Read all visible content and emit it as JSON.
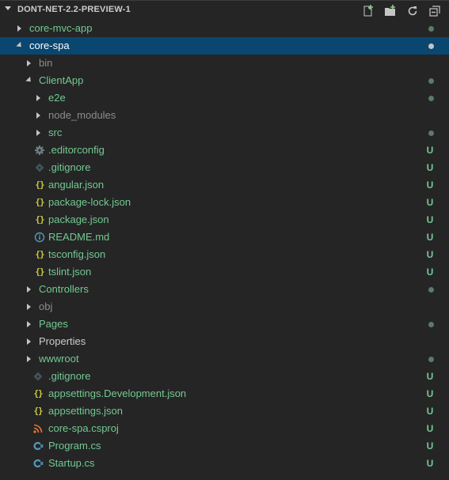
{
  "explorer": {
    "title": "DONT-NET-2.2-PREVIEW-1",
    "actions": [
      {
        "name": "new-file-icon",
        "label": "New File"
      },
      {
        "name": "new-folder-icon",
        "label": "New Folder"
      },
      {
        "name": "refresh-icon",
        "label": "Refresh Explorer"
      },
      {
        "name": "collapse-all-icon",
        "label": "Collapse All"
      }
    ]
  },
  "colors": {
    "untracked": "#73c991",
    "modified_dot": "#73c991",
    "ignored": "#8c8c8c",
    "default": "#cccccc",
    "selected_bg": "#094771",
    "json_icon": "#cbcb41",
    "info_icon": "#519aba",
    "xml_icon": "#e37933",
    "csharp_icon": "#519aba",
    "gear_icon": "#6d8086"
  },
  "tree": [
    {
      "label": "core-mvc-app",
      "kind": "folder",
      "expanded": false,
      "depth": 0,
      "color": "untracked",
      "status": "dot",
      "icon": "none"
    },
    {
      "label": "core-spa",
      "kind": "folder",
      "expanded": true,
      "depth": 0,
      "color": "default",
      "status": "dot",
      "icon": "none",
      "selected": true
    },
    {
      "label": "bin",
      "kind": "folder",
      "expanded": false,
      "depth": 1,
      "color": "ignored",
      "status": "",
      "icon": "none"
    },
    {
      "label": "ClientApp",
      "kind": "folder",
      "expanded": true,
      "depth": 1,
      "color": "untracked",
      "status": "dot",
      "icon": "none"
    },
    {
      "label": "e2e",
      "kind": "folder",
      "expanded": false,
      "depth": 2,
      "color": "untracked",
      "status": "dot",
      "icon": "none"
    },
    {
      "label": "node_modules",
      "kind": "folder",
      "expanded": false,
      "depth": 2,
      "color": "ignored",
      "status": "",
      "icon": "none"
    },
    {
      "label": "src",
      "kind": "folder",
      "expanded": false,
      "depth": 2,
      "color": "untracked",
      "status": "dot",
      "icon": "none"
    },
    {
      "label": ".editorconfig",
      "kind": "file",
      "depth": 2,
      "color": "untracked",
      "status": "U",
      "icon": "gear-icon"
    },
    {
      "label": ".gitignore",
      "kind": "file",
      "depth": 2,
      "color": "untracked",
      "status": "U",
      "icon": "git-icon"
    },
    {
      "label": "angular.json",
      "kind": "file",
      "depth": 2,
      "color": "untracked",
      "status": "U",
      "icon": "json-icon"
    },
    {
      "label": "package-lock.json",
      "kind": "file",
      "depth": 2,
      "color": "untracked",
      "status": "U",
      "icon": "json-icon"
    },
    {
      "label": "package.json",
      "kind": "file",
      "depth": 2,
      "color": "untracked",
      "status": "U",
      "icon": "json-icon"
    },
    {
      "label": "README.md",
      "kind": "file",
      "depth": 2,
      "color": "untracked",
      "status": "U",
      "icon": "info-icon"
    },
    {
      "label": "tsconfig.json",
      "kind": "file",
      "depth": 2,
      "color": "untracked",
      "status": "U",
      "icon": "json-icon"
    },
    {
      "label": "tslint.json",
      "kind": "file",
      "depth": 2,
      "color": "untracked",
      "status": "U",
      "icon": "json-icon"
    },
    {
      "label": "Controllers",
      "kind": "folder",
      "expanded": false,
      "depth": 1,
      "color": "untracked",
      "status": "dot",
      "icon": "none"
    },
    {
      "label": "obj",
      "kind": "folder",
      "expanded": false,
      "depth": 1,
      "color": "ignored",
      "status": "",
      "icon": "none"
    },
    {
      "label": "Pages",
      "kind": "folder",
      "expanded": false,
      "depth": 1,
      "color": "untracked",
      "status": "dot",
      "icon": "none"
    },
    {
      "label": "Properties",
      "kind": "folder",
      "expanded": false,
      "depth": 1,
      "color": "default",
      "status": "",
      "icon": "none"
    },
    {
      "label": "wwwroot",
      "kind": "folder",
      "expanded": false,
      "depth": 1,
      "color": "untracked",
      "status": "dot",
      "icon": "none"
    },
    {
      "label": ".gitignore",
      "kind": "file",
      "depth": 1,
      "color": "untracked",
      "status": "U",
      "icon": "git-icon"
    },
    {
      "label": "appsettings.Development.json",
      "kind": "file",
      "depth": 1,
      "color": "untracked",
      "status": "U",
      "icon": "json-icon"
    },
    {
      "label": "appsettings.json",
      "kind": "file",
      "depth": 1,
      "color": "untracked",
      "status": "U",
      "icon": "json-icon"
    },
    {
      "label": "core-spa.csproj",
      "kind": "file",
      "depth": 1,
      "color": "untracked",
      "status": "U",
      "icon": "rss-icon"
    },
    {
      "label": "Program.cs",
      "kind": "file",
      "depth": 1,
      "color": "untracked",
      "status": "U",
      "icon": "csharp-icon"
    },
    {
      "label": "Startup.cs",
      "kind": "file",
      "depth": 1,
      "color": "untracked",
      "status": "U",
      "icon": "csharp-icon"
    }
  ]
}
